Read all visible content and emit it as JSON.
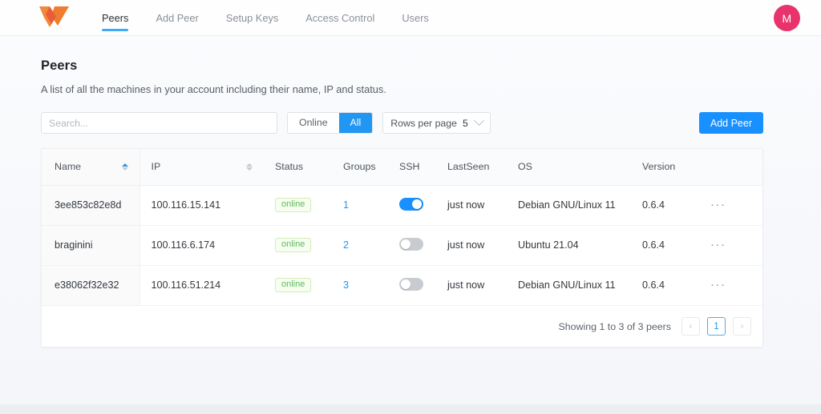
{
  "header": {
    "logo_icon": "netbird-logo-icon",
    "nav": [
      {
        "label": "Peers",
        "active": true
      },
      {
        "label": "Add Peer",
        "active": false
      },
      {
        "label": "Setup Keys",
        "active": false
      },
      {
        "label": "Access Control",
        "active": false
      },
      {
        "label": "Users",
        "active": false
      }
    ],
    "avatar_initial": "M",
    "avatar_color": "#e8336d"
  },
  "page": {
    "title": "Peers",
    "subtitle": "A list of all the machines in your account including their name, IP and status."
  },
  "toolbar": {
    "search_placeholder": "Search...",
    "search_value": "",
    "filter_online_label": "Online",
    "filter_all_label": "All",
    "rows_per_page_label": "Rows per page",
    "rows_per_page_value": "5",
    "add_peer_label": "Add Peer",
    "accent_color": "#1890ff"
  },
  "table": {
    "columns": [
      {
        "key": "name",
        "label": "Name",
        "sortable": true,
        "sort": "asc"
      },
      {
        "key": "ip",
        "label": "IP",
        "sortable": true,
        "sort": "none"
      },
      {
        "key": "status",
        "label": "Status",
        "sortable": false
      },
      {
        "key": "groups",
        "label": "Groups",
        "sortable": false
      },
      {
        "key": "ssh",
        "label": "SSH",
        "sortable": false
      },
      {
        "key": "lastseen",
        "label": "LastSeen",
        "sortable": false
      },
      {
        "key": "os",
        "label": "OS",
        "sortable": false
      },
      {
        "key": "version",
        "label": "Version",
        "sortable": false
      },
      {
        "key": "actions",
        "label": "",
        "sortable": false
      }
    ],
    "rows": [
      {
        "name": "3ee853c82e8d",
        "ip": "100.116.15.141",
        "status": "online",
        "groups": "1",
        "ssh_on": true,
        "lastseen": "just now",
        "os": "Debian GNU/Linux 11",
        "version": "0.6.4",
        "actions": "···"
      },
      {
        "name": "braginini",
        "ip": "100.116.6.174",
        "status": "online",
        "groups": "2",
        "ssh_on": false,
        "lastseen": "just now",
        "os": "Ubuntu 21.04",
        "version": "0.6.4",
        "actions": "···"
      },
      {
        "name": "e38062f32e32",
        "ip": "100.116.51.214",
        "status": "online",
        "groups": "3",
        "ssh_on": false,
        "lastseen": "just now",
        "os": "Debian GNU/Linux 11",
        "version": "0.6.4",
        "actions": "···"
      }
    ],
    "status_badge_color": "#5eb85e"
  },
  "pagination": {
    "showing_text": "Showing 1 to 3 of 3 peers",
    "prev_label": "‹",
    "current_page": "1",
    "next_label": "›"
  }
}
